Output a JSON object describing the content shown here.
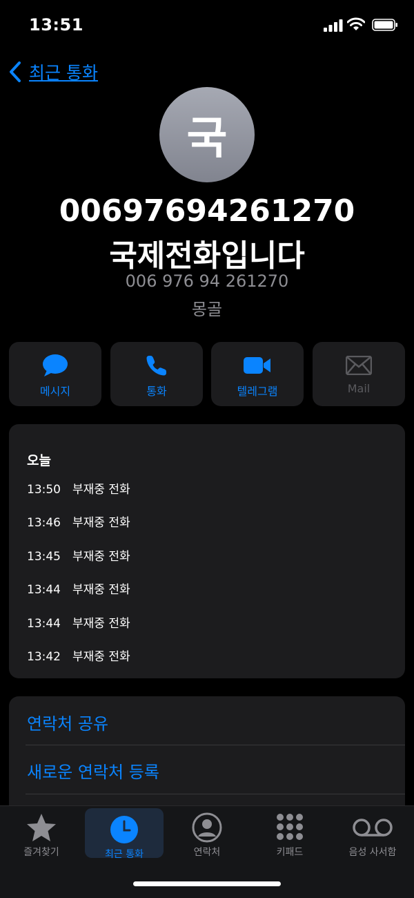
{
  "status_bar": {
    "time": "13:51"
  },
  "nav": {
    "back_label": "최근 통화"
  },
  "contact": {
    "avatar_initial": "국",
    "number": "00697694261270",
    "subtitle": "국제전화입니다",
    "formatted_number": "006 976 94 261270",
    "country": "몽골"
  },
  "actions": [
    {
      "label": "메시지",
      "icon": "message-bubble-icon",
      "enabled": true
    },
    {
      "label": "통화",
      "icon": "phone-icon",
      "enabled": true
    },
    {
      "label": "텔레그램",
      "icon": "video-camera-icon",
      "enabled": true
    },
    {
      "label": "Mail",
      "icon": "envelope-icon",
      "enabled": false
    }
  ],
  "calls": {
    "header": "오늘",
    "entries": [
      {
        "time": "13:50",
        "type": "부재중 전화"
      },
      {
        "time": "13:46",
        "type": "부재중 전화"
      },
      {
        "time": "13:45",
        "type": "부재중 전화"
      },
      {
        "time": "13:44",
        "type": "부재중 전화"
      },
      {
        "time": "13:44",
        "type": "부재중 전화"
      },
      {
        "time": "13:42",
        "type": "부재중 전화"
      }
    ]
  },
  "options": [
    {
      "label": "연락처 공유"
    },
    {
      "label": "새로운 연락처 등록"
    }
  ],
  "tabs": [
    {
      "label": "즐겨찾기",
      "icon": "star-icon",
      "active": false
    },
    {
      "label": "최근 통화",
      "icon": "clock-icon",
      "active": true
    },
    {
      "label": "연락처",
      "icon": "person-circle-icon",
      "active": false
    },
    {
      "label": "키패드",
      "icon": "keypad-icon",
      "active": false
    },
    {
      "label": "음성 사서함",
      "icon": "voicemail-icon",
      "active": false
    }
  ],
  "colors": {
    "accent": "#0a84ff",
    "background": "#000000",
    "card": "#1c1c1e",
    "muted": "#8e8e93"
  }
}
